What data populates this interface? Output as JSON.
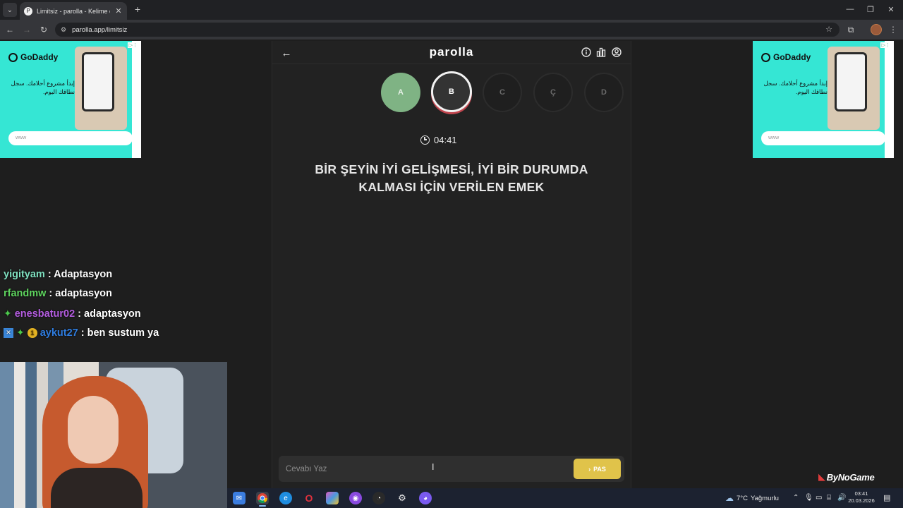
{
  "browser": {
    "tab_title": "Limitsiz - parolla - Kelime oyunu",
    "url": "parolla.app/limitsiz",
    "controls": {
      "minimize": "—",
      "restore": "❐",
      "close": "✕",
      "new_tab": "+",
      "tab_close": "✕",
      "tab_list": "⌄"
    }
  },
  "ads": {
    "brand": "GoDaddy",
    "text": "إبدأ مشروع أحلامك. سجل نطاقك اليوم.",
    "search_placeholder": "www"
  },
  "game": {
    "title": "parolla",
    "letters": [
      {
        "letter": "A",
        "state": "done"
      },
      {
        "letter": "B",
        "state": "current"
      },
      {
        "letter": "C",
        "state": "pending"
      },
      {
        "letter": "Ç",
        "state": "pending"
      },
      {
        "letter": "D",
        "state": "pending"
      }
    ],
    "timer": "04:41",
    "question": "BİR ŞEYİN İYİ GELİŞMESİ, İYİ BİR DURUMDA KALMASI İÇİN VERİLEN EMEK",
    "answer_placeholder": "Cevabı Yaz",
    "pass_label": "PAS"
  },
  "chat": [
    {
      "user": "yigityam",
      "user_color": "#7fe0c0",
      "message": ": Adaptasyon",
      "badges": []
    },
    {
      "user": "rfandmw",
      "user_color": "#5ed35e",
      "message": ": adaptasyon",
      "badges": []
    },
    {
      "user": "enesbatur02",
      "user_color": "#b45de0",
      "message": ": adaptasyon",
      "badges": [
        "star"
      ]
    },
    {
      "user": "aykut27",
      "user_color": "#2f7de0",
      "message": ": ben sustum ya",
      "badges": [
        "square",
        "star",
        "coin"
      ]
    }
  ],
  "overlay_brand": "ByNoGame",
  "taskbar": {
    "weather_temp": "7°C",
    "weather_text": "Yağmurlu",
    "time": "03:41",
    "date": "20.03.2026"
  },
  "colors": {
    "correct": "#7fb384",
    "current_ring": "#c0454e",
    "pass_button": "#e0c34a"
  }
}
